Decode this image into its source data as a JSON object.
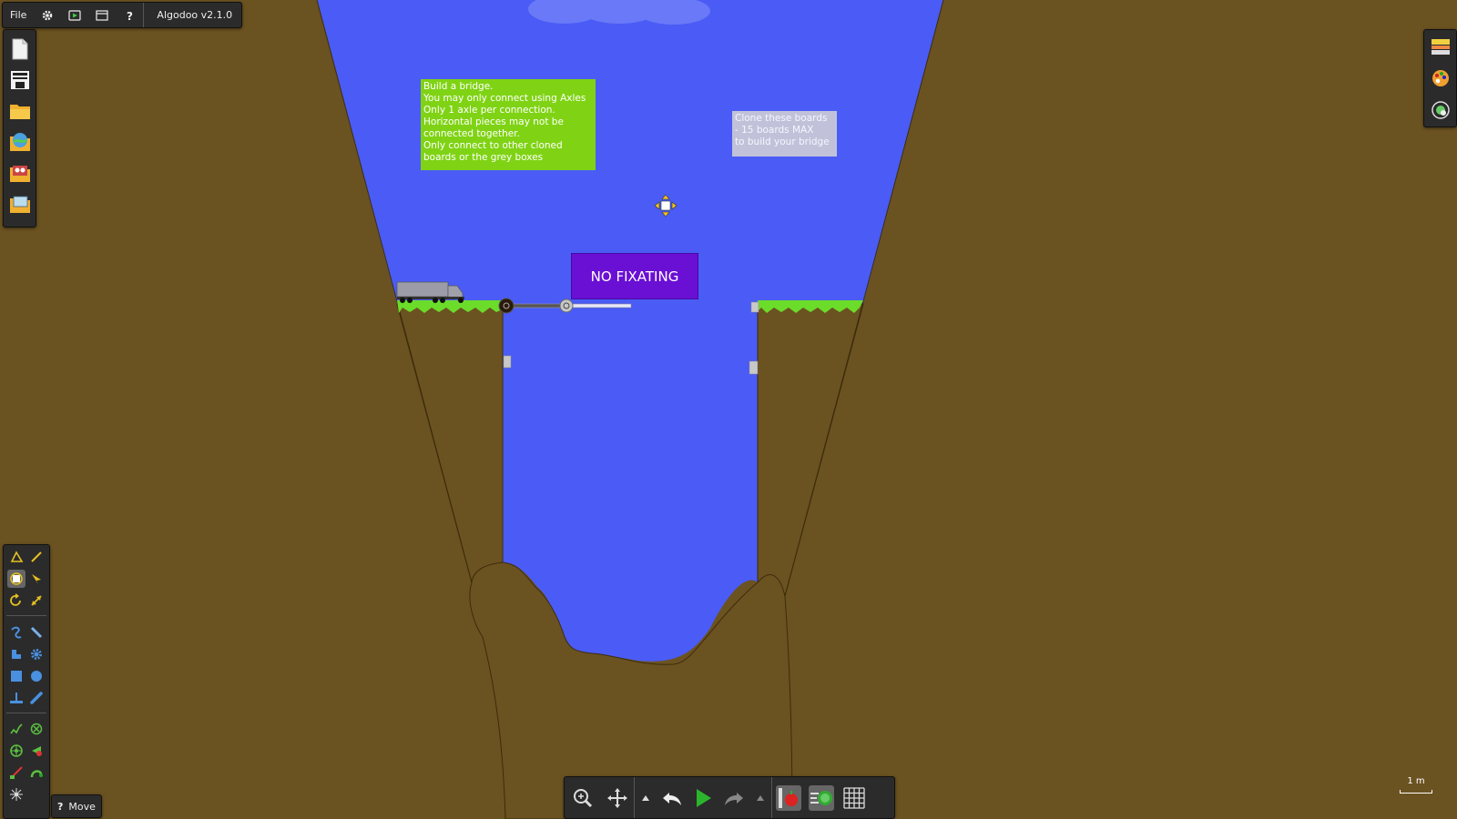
{
  "topbar": {
    "file_label": "File",
    "version_label": "Algodoo v2.1.0"
  },
  "scene": {
    "instructions_text": "Build a bridge.\nYou may only connect using Axles\nOnly 1 axle per connection.\nHorizontal pieces may not be connected together.\nOnly connect to other cloned boards or the grey boxes",
    "clone_text": "Clone these boards\n- 15 boards MAX\nto build your bridge",
    "warning_text": "NO FIXATING"
  },
  "status": {
    "hint_icon": "?",
    "tool_name": "Move"
  },
  "scale_label": "1 m",
  "colors": {
    "sky": "#4a5cf5",
    "ground": "#6b5221",
    "grass": "#6bdc2a",
    "instruction_note": "#7fd314",
    "warning_box": "#6a0fd4",
    "toolbar": "#2b2b2b"
  },
  "icons": {
    "topbar": [
      "settings-gear-icon",
      "play-screen-icon",
      "window-icon",
      "help-icon"
    ],
    "file_panel": [
      "new-scene-icon",
      "save-icon",
      "open-folder-icon",
      "browse-online-icon",
      "open-phunlets-icon",
      "open-scene-icon"
    ],
    "right_panel": [
      "background-icon",
      "palette-icon",
      "options-icon"
    ],
    "bottom_bar": [
      "zoom-icon",
      "pan-icon",
      "undo-menu-icon",
      "undo-icon",
      "play-icon",
      "redo-icon",
      "redo-menu-icon",
      "gravity-icon",
      "air-friction-icon",
      "grid-icon"
    ]
  }
}
